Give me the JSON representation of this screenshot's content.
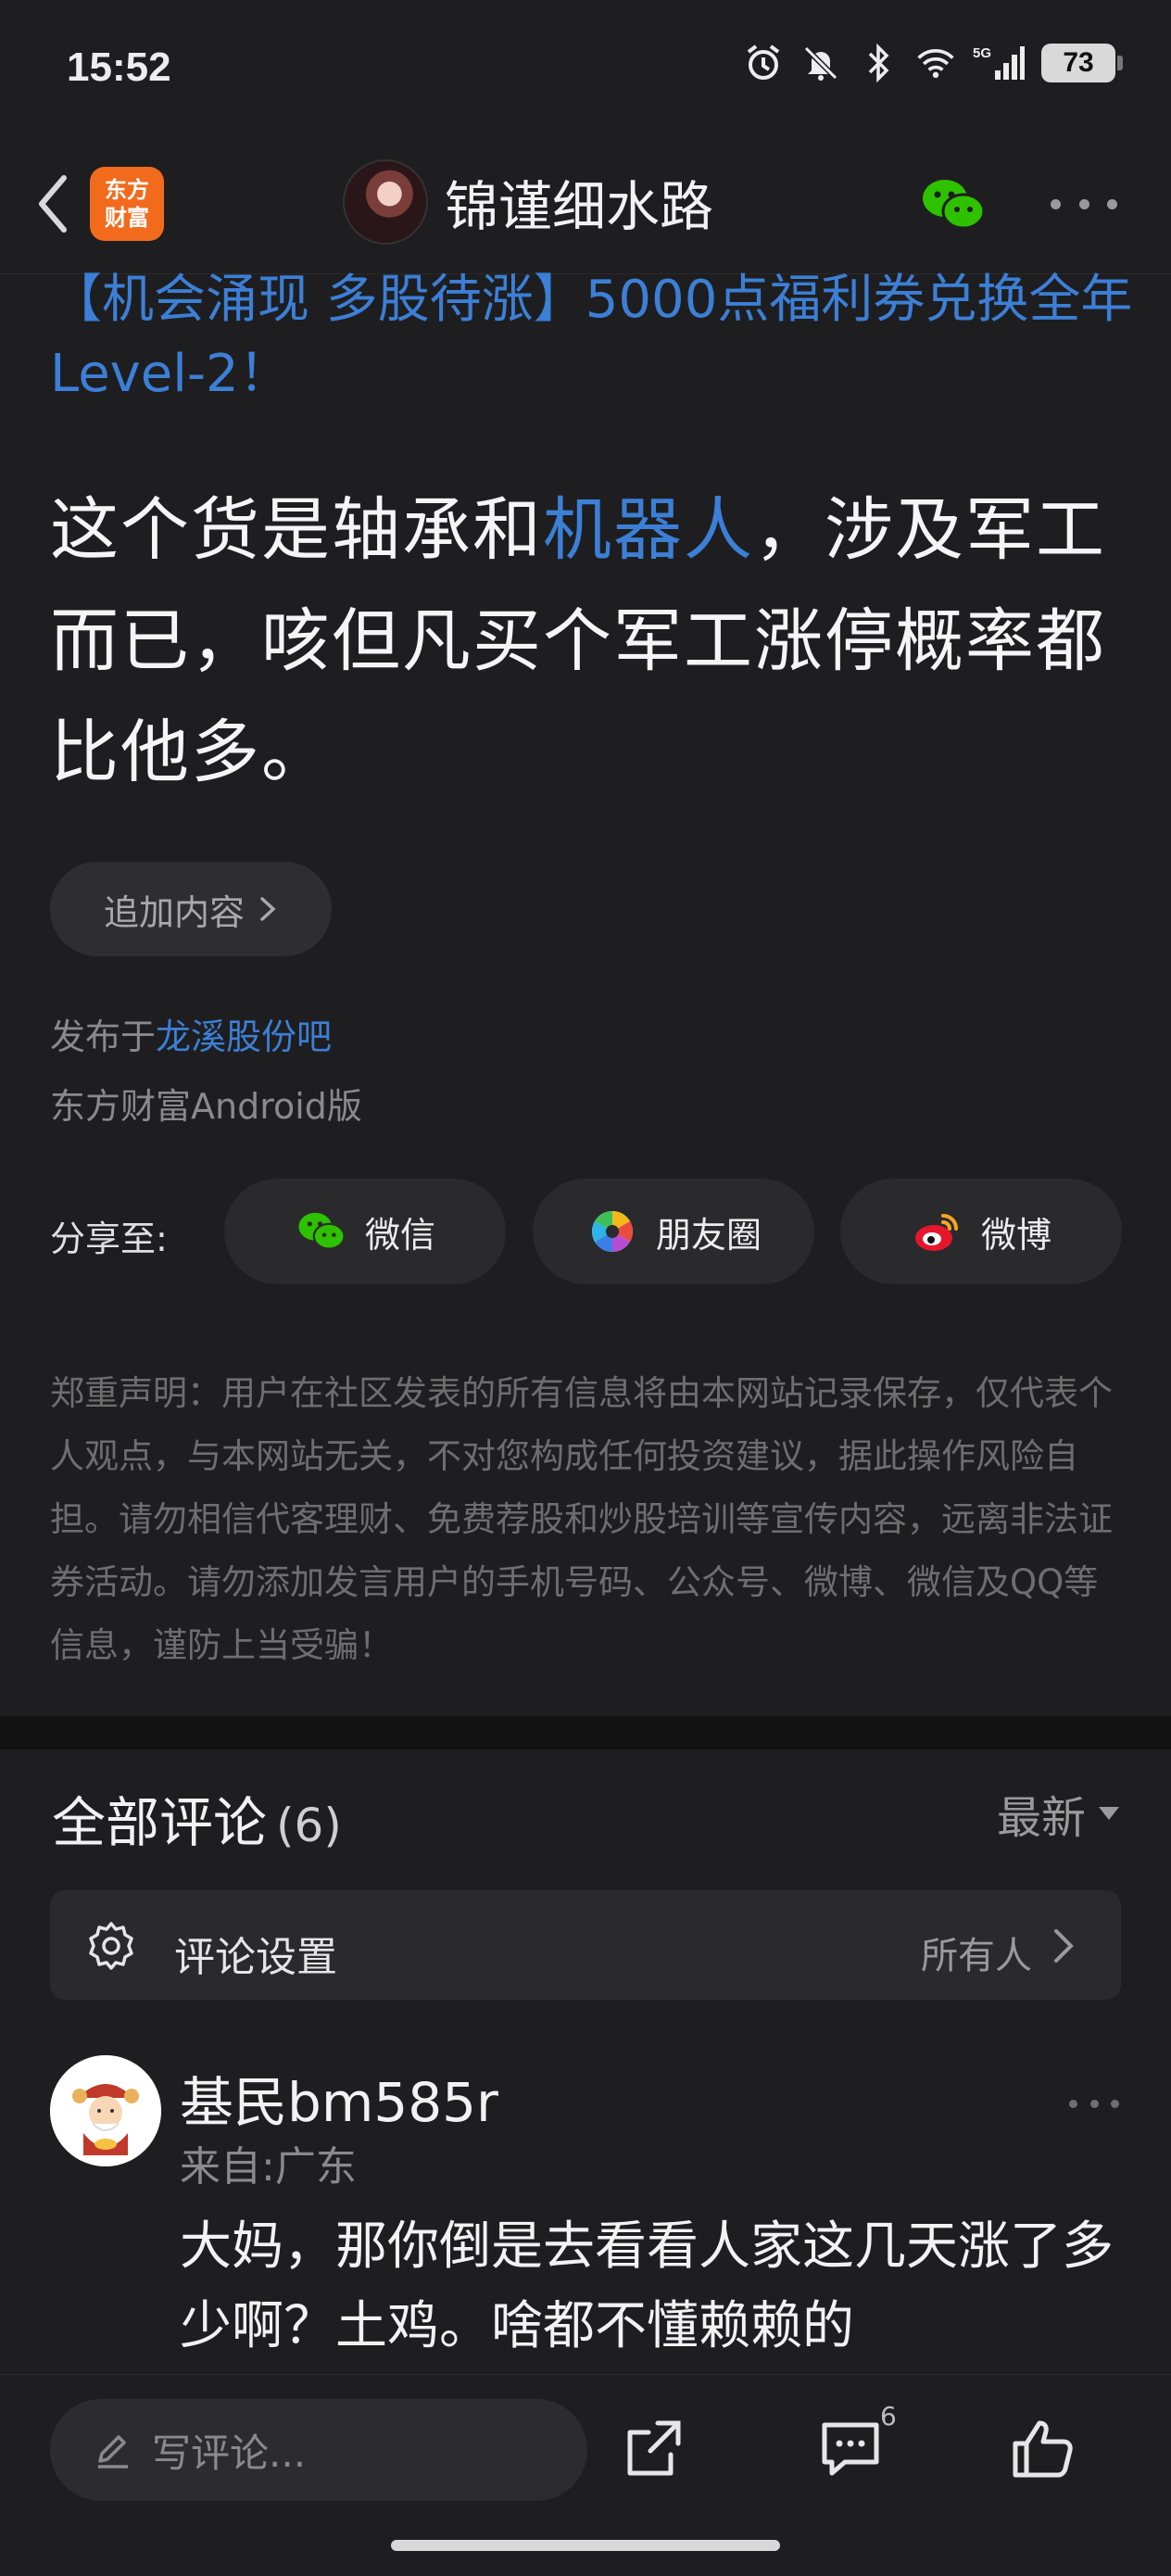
{
  "status_bar": {
    "time": "15:52",
    "network": "5G",
    "battery": "73"
  },
  "nav": {
    "app_logo_line1": "东方",
    "app_logo_line2": "财富",
    "username": "锦谨细水路"
  },
  "post": {
    "promo": "【机会涌现 多股待涨】5000点福利券兑换全年Level-2！",
    "body_before": "这个货是轴承和",
    "body_link": "机器人",
    "body_after": "，涉及军工而已，咳但凡买个军工涨停概率都比他多。",
    "append_label": "追加内容",
    "published_prefix": "发布于",
    "forum": "龙溪股份吧",
    "client": "东方财富Android版"
  },
  "share": {
    "label": "分享至:",
    "wechat": "微信",
    "moments": "朋友圈",
    "weibo": "微博"
  },
  "disclaimer": "郑重声明：用户在社区发表的所有信息将由本网站记录保存，仅代表个人观点，与本网站无关，不对您构成任何投资建议，据此操作风险自担。请勿相信代客理财、免费荐股和炒股培训等宣传内容，远离非法证券活动。请勿添加发言用户的手机号码、公众号、微博、微信及QQ等信息，谨防上当受骗！",
  "comments": {
    "title": "全部评论",
    "count": "(6)",
    "sort": "最新",
    "settings_label": "评论设置",
    "settings_value": "所有人",
    "items": [
      {
        "name": "基民bm585r",
        "location": "来自:广东",
        "text": "大妈，那你倒是去看看人家这几天涨了多少啊？土鸡。啥都不懂赖赖的"
      }
    ]
  },
  "bottom_bar": {
    "placeholder": "写评论...",
    "comment_badge": "6"
  },
  "colors": {
    "background": "#1e1e20",
    "link_blue": "#3c7fd6",
    "logo_orange": "#f26b1d",
    "wechat_green": "#2dc100"
  }
}
